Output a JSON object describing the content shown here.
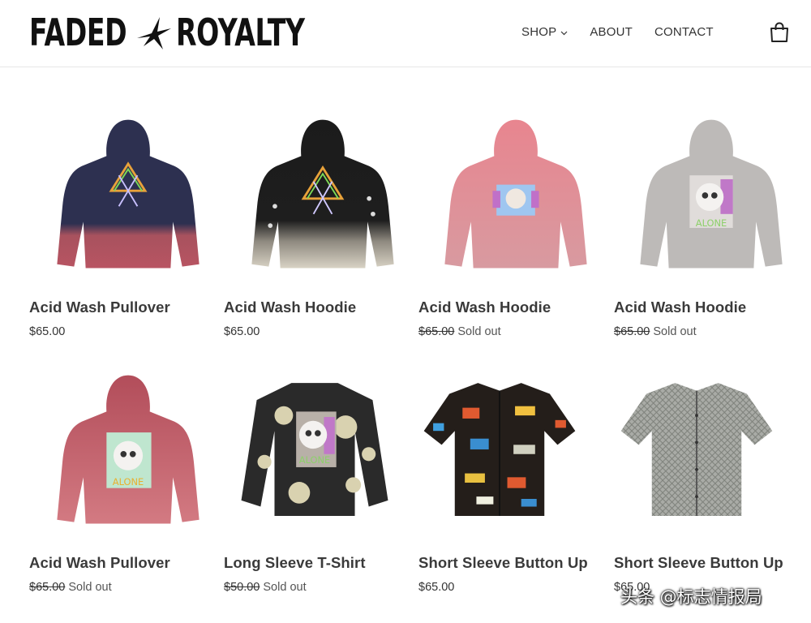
{
  "header": {
    "logo_left": "FADED",
    "logo_right": "ROYALTY",
    "nav": [
      {
        "label": "SHOP",
        "has_dropdown": true
      },
      {
        "label": "ABOUT",
        "has_dropdown": false
      },
      {
        "label": "CONTACT",
        "has_dropdown": false
      }
    ],
    "cart_icon": "shopping-bag-icon"
  },
  "products": [
    {
      "title": "Acid Wash Pullover",
      "price": "$65.00",
      "sold_out": false,
      "sold_label": "",
      "image": "hoodie-navy-red-dip"
    },
    {
      "title": "Acid Wash Hoodie",
      "price": "$65.00",
      "sold_out": false,
      "sold_label": "",
      "image": "hoodie-black-bleach"
    },
    {
      "title": "Acid Wash Hoodie",
      "price": "$65.00",
      "sold_out": true,
      "sold_label": "Sold out",
      "image": "hoodie-pink"
    },
    {
      "title": "Acid Wash Hoodie",
      "price": "$65.00",
      "sold_out": true,
      "sold_label": "Sold out",
      "image": "hoodie-grey-skull"
    },
    {
      "title": "Acid Wash Pullover",
      "price": "$65.00",
      "sold_out": true,
      "sold_label": "Sold out",
      "image": "hoodie-red-skull"
    },
    {
      "title": "Long Sleeve T-Shirt",
      "price": "$50.00",
      "sold_out": true,
      "sold_label": "Sold out",
      "image": "longsleeve-bleach-skull"
    },
    {
      "title": "Short Sleeve Button Up",
      "price": "$65.00",
      "sold_out": false,
      "sold_label": "",
      "image": "shirt-black-print"
    },
    {
      "title": "Short Sleeve Button Up",
      "price": "$65.00",
      "sold_out": false,
      "sold_label": "",
      "image": "shirt-grey-print"
    }
  ],
  "watermark": "头条 @标志情报局",
  "colors": {
    "navy": "#2b2f4a",
    "red_dip": "#b8505a",
    "black": "#1b1b1b",
    "pink": "#e58a92",
    "grey": "#bdbab8",
    "text": "#3a3a3a"
  }
}
